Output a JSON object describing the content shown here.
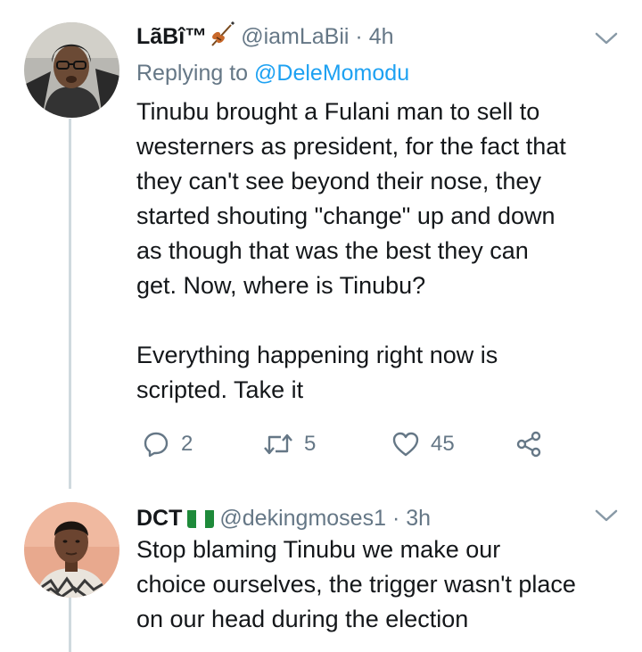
{
  "tweets": [
    {
      "display_name": "LãBî™",
      "handle": "@iamLaBii",
      "separator": "·",
      "time": "4h",
      "replying_prefix": "Replying to",
      "replying_to": "@DeleMomodu",
      "text": "Tinubu brought a Fulani man to sell to\nwesterners as president, for the fact that\nthey can't see beyond their nose, they\nstarted shouting \"change\" up and down\nas though that was the best they can\nget. Now, where is Tinubu?\n\nEverything happening right now is\nscripted. Take it",
      "reply_count": "2",
      "retweet_count": "5",
      "like_count": "45",
      "emoji_icon": "violin-icon"
    },
    {
      "display_name": "DCT",
      "handle": "@dekingmoses1",
      "separator": "·",
      "time": "3h",
      "text": "Stop blaming Tinubu we make our\nchoice ourselves, the trigger wasn't place\non our head during the election",
      "emoji_icon": "nigeria-flag-icon"
    }
  ],
  "colors": {
    "text": "#14171a",
    "muted": "#657786",
    "link": "#1da1f2",
    "thread_line": "#cfd9de"
  }
}
